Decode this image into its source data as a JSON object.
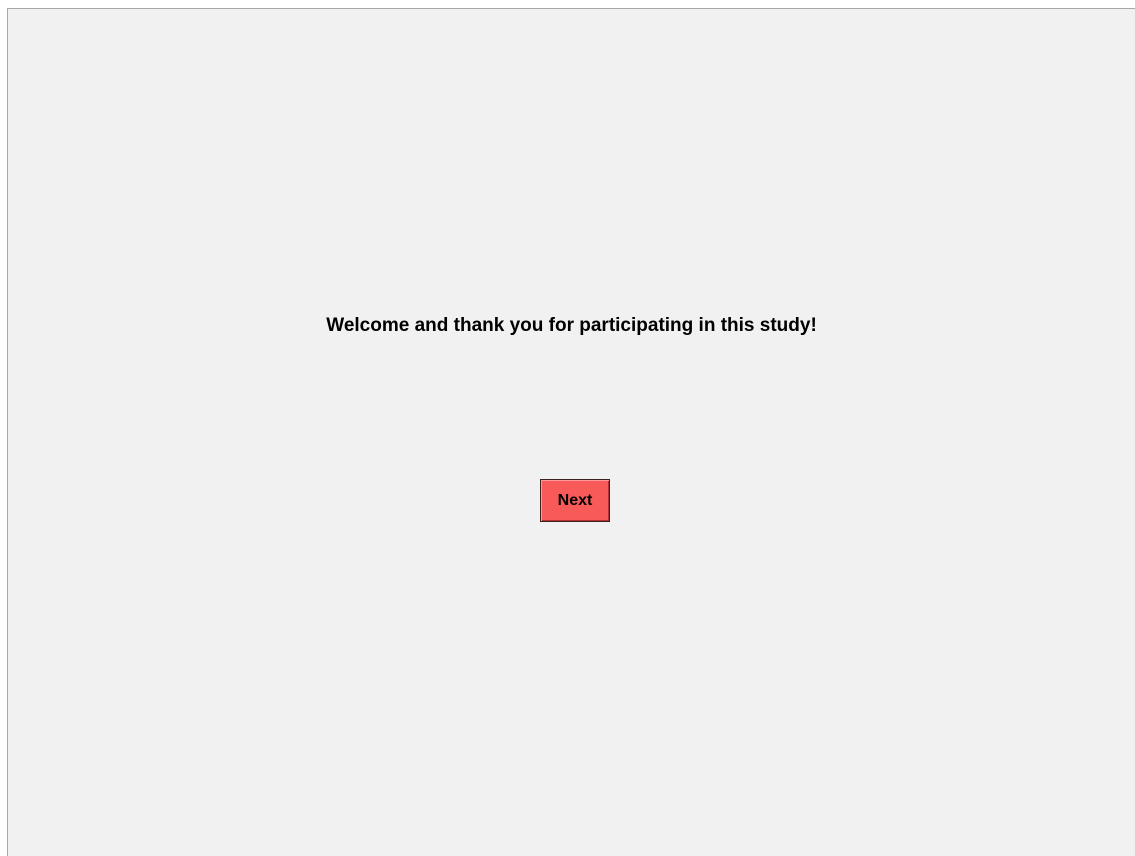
{
  "welcome": {
    "message": "Welcome and thank you for participating in this study!"
  },
  "navigation": {
    "next_label": "Next"
  },
  "colors": {
    "background": "#f1f1f1",
    "next_button": "#f85a5a"
  }
}
